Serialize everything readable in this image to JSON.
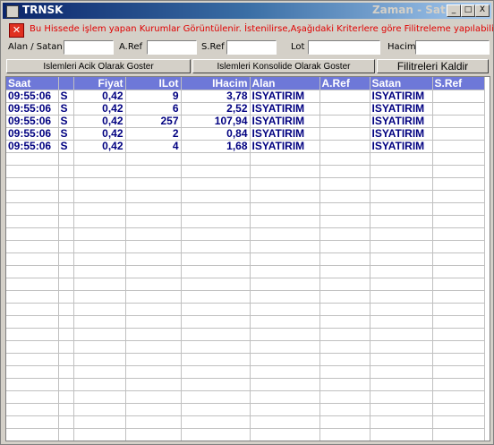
{
  "window": {
    "title": "TRNSK",
    "title_right": "Zaman - Satis",
    "min_label": "_",
    "max_label": "□",
    "close_label": "X"
  },
  "info": {
    "icon_label": "✕",
    "text": "Bu Hissede işlem yapan Kurumlar Görüntülenir. İstenilirse,Aşağıdaki Kriterlere göre Filitreleme yapılabilir."
  },
  "filters": {
    "alan_satan_label": "Alan / Satan",
    "aref_label": "A.Ref",
    "sref_label": "S.Ref",
    "lot_label": "Lot",
    "hacim_label": "Hacim",
    "alan_satan_value": "",
    "aref_value": "",
    "sref_value": "",
    "lot_value": "",
    "hacim_value": ""
  },
  "buttons": {
    "acik": "Islemleri Acik Olarak Goster",
    "konsolide": "Islemleri Konsolide Olarak Goster",
    "filtre": "Filitreleri Kaldir"
  },
  "table": {
    "headers": [
      "Saat",
      "",
      "Fiyat",
      "ILot",
      "IHacim",
      "Alan",
      "A.Ref",
      "Satan",
      "S.Ref"
    ],
    "rows": [
      [
        "09:55:06",
        "S",
        "0,42",
        "9",
        "3,78",
        "ISYATIRIM",
        "",
        "ISYATIRIM",
        ""
      ],
      [
        "09:55:06",
        "S",
        "0,42",
        "6",
        "2,52",
        "ISYATIRIM",
        "",
        "ISYATIRIM",
        ""
      ],
      [
        "09:55:06",
        "S",
        "0,42",
        "257",
        "107,94",
        "ISYATIRIM",
        "",
        "ISYATIRIM",
        ""
      ],
      [
        "09:55:06",
        "S",
        "0,42",
        "2",
        "0,84",
        "ISYATIRIM",
        "",
        "ISYATIRIM",
        ""
      ],
      [
        "09:55:06",
        "S",
        "0,42",
        "4",
        "1,68",
        "ISYATIRIM",
        "",
        "ISYATIRIM",
        ""
      ]
    ]
  },
  "colors": {
    "header_bg": "#6e78d8",
    "selected_row": "#316ac5",
    "row_text": "#000080",
    "info_text": "#e00000"
  }
}
